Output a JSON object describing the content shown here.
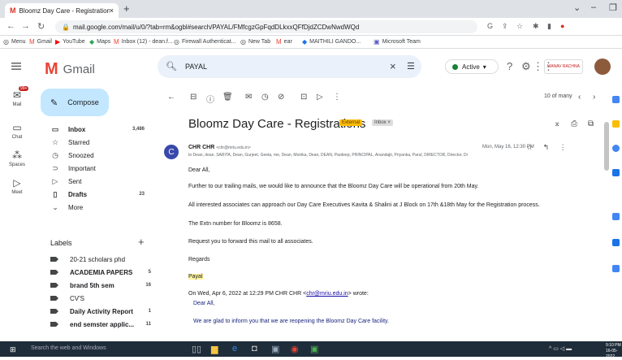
{
  "browser": {
    "tab_title": "Bloomz Day Care - Registrations",
    "tab_close": "×",
    "new_tab": "+",
    "url": "mail.google.com/mail/u/0/?tab=rm&ogbl#search/PAYAL/FMfcgzGpFqdDLkxxQFfDjdZCDwNwdWQd",
    "bookmarks": [
      "Menu",
      "Gmail",
      "YouTube",
      "Maps",
      "Inbox (12) - dean.f...",
      "Firewall Authenticat...",
      "New Tab",
      "ear",
      "MAITHILI GANDO...",
      "Microsoft Team"
    ]
  },
  "header": {
    "app_name": "Gmail",
    "search_value": "PAYAL",
    "status": "Active",
    "org_logo": "MANAV RACHNA"
  },
  "rail": {
    "badge": "99+",
    "items": [
      "Mail",
      "Chat",
      "Spaces",
      "Meet"
    ]
  },
  "nav": {
    "compose": "Compose",
    "items": [
      {
        "label": "Inbox",
        "count": "3,486",
        "icon": "inbox-icon"
      },
      {
        "label": "Starred",
        "count": "",
        "icon": "star-icon"
      },
      {
        "label": "Snoozed",
        "count": "",
        "icon": "clock-icon"
      },
      {
        "label": "Important",
        "count": "",
        "icon": "important-icon"
      },
      {
        "label": "Sent",
        "count": "",
        "icon": "send-icon"
      },
      {
        "label": "Drafts",
        "count": "23",
        "icon": "draft-icon"
      },
      {
        "label": "More",
        "count": "",
        "icon": "chevron-down-icon"
      }
    ],
    "labels_title": "Labels",
    "labels": [
      {
        "label": "20-21 scholars phd",
        "count": ""
      },
      {
        "label": "ACADEMIA PAPERS",
        "count": "5"
      },
      {
        "label": "brand 5th sem",
        "count": "16"
      },
      {
        "label": "CV'S",
        "count": ""
      },
      {
        "label": "Daily Activity Report",
        "count": "1"
      },
      {
        "label": "end semster applic...",
        "count": "11"
      }
    ]
  },
  "message": {
    "pager": "10 of many",
    "subject": "Bloomz Day Care - Registrations",
    "external_chip": "External",
    "inbox_chip": "Inbox ×",
    "sender_initial": "C",
    "sender_name": "CHR CHR",
    "sender_email": "<chr@mriu.edu.in>",
    "date": "Mon, May 16, 12:30 PM",
    "recipients": "to Dean, dean, SARITA, Dean, Gurjeet, Geeta, me, Dean, Monika, Dean, DEAN, Pardeep, PRINCIPAL, Anandajit, Priyanka, Parul, DIRECTOR, Director, Di",
    "body": [
      "Dear All,",
      "Further to our trailing mails, we would like to announce that the Bloomz Day Care will be operational from 20th May.",
      "All interested associates can approach our Day Care Executives Kavita & Shalini at J Block on 17th &18th May for the Registration process.",
      "The Extn number for Bloomz is 8658.",
      "Request you to forward this mail to all associates.",
      "Regards"
    ],
    "signature": "Payal",
    "quote_prefix": "On Wed, Apr 6, 2022 at 12:29 PM CHR CHR <",
    "quote_link": "chr@mriu.edu.in",
    "quote_suffix": "> wrote:",
    "quote_lines": [
      "Dear All,",
      "We are glad to inform you that we are reopening the Bloomz Day Care facility."
    ]
  },
  "taskbar": {
    "search_placeholder": "Search the web and Windows",
    "time": "9:10 PM",
    "date": "16-05-2022"
  }
}
